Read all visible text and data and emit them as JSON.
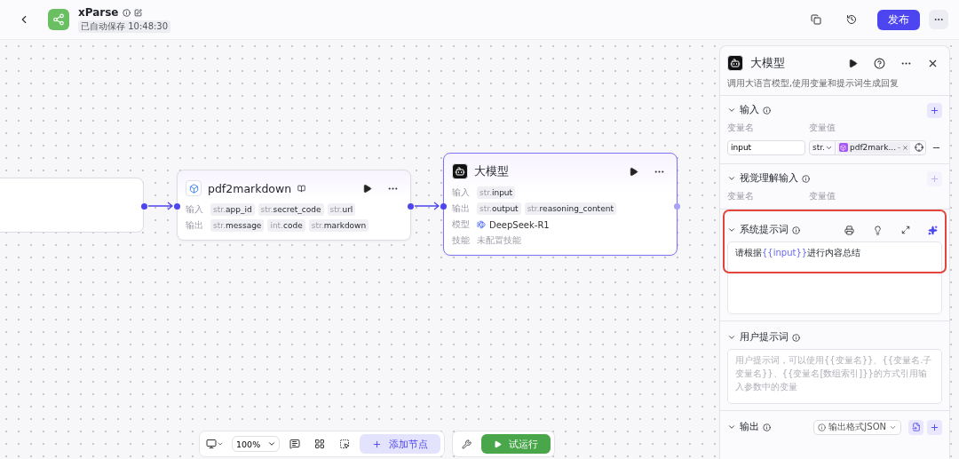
{
  "header": {
    "title": "xParse",
    "save_status": "已自动保存 10:48:30",
    "publish": "发布"
  },
  "nodes": [
    {
      "kind": "plugin",
      "title": "pdf2markdown",
      "selected": false,
      "rows": [
        {
          "kind": "tags",
          "label": "输入",
          "tags": [
            {
              "type": "str.",
              "name": "app_id"
            },
            {
              "type": "str.",
              "name": "secret_code"
            },
            {
              "type": "str.",
              "name": "url"
            }
          ]
        },
        {
          "kind": "tags",
          "label": "输出",
          "tags": [
            {
              "type": "str.",
              "name": "message"
            },
            {
              "type": "int.",
              "name": "code"
            },
            {
              "type": "str.",
              "name": "markdown"
            }
          ]
        }
      ]
    },
    {
      "kind": "llm",
      "title": "大模型",
      "selected": true,
      "rows": [
        {
          "kind": "tags",
          "label": "输入",
          "tags": [
            {
              "type": "str.",
              "name": "input"
            }
          ]
        },
        {
          "kind": "tags",
          "label": "输出",
          "tags": [
            {
              "type": "str.",
              "name": "output"
            },
            {
              "type": "str.",
              "name": "reasoning_content"
            }
          ]
        },
        {
          "kind": "model",
          "label": "模型",
          "value": "DeepSeek-R1"
        },
        {
          "kind": "muted",
          "label": "技能",
          "value": "未配置技能"
        }
      ]
    }
  ],
  "panel": {
    "title": "大模型",
    "description": "调用大语言模型,使用变量和提示词生成回复",
    "input": {
      "title": "输入",
      "columns": [
        "变量名",
        "变量值"
      ],
      "rows": [
        {
          "name": "input",
          "type": "str.",
          "ref": "pdf2mark...",
          "ref_suffix": "-"
        }
      ]
    },
    "vision": {
      "title": "视觉理解输入",
      "columns": [
        "变量名",
        "变量值"
      ],
      "add_disabled": true
    },
    "system_prompt": {
      "title": "系统提示词",
      "highlighted": true,
      "parts": [
        {
          "kind": "plain",
          "text": "请根据"
        },
        {
          "kind": "variable",
          "text": "{{input}}"
        },
        {
          "kind": "plain",
          "text": "进行内容总结"
        }
      ]
    },
    "user_prompt": {
      "title": "用户提示词",
      "placeholder": "用户提示词，可以使用{{变量名}}、{{变量名.子变量名}}、{{变量名[数组索引]}}的方式引用输入参数中的变量"
    },
    "output": {
      "title": "输出",
      "format": "输出格式JSON"
    }
  },
  "toolbar": {
    "zoom": "100%",
    "add_node": "添加节点",
    "test_run": "试运行"
  }
}
